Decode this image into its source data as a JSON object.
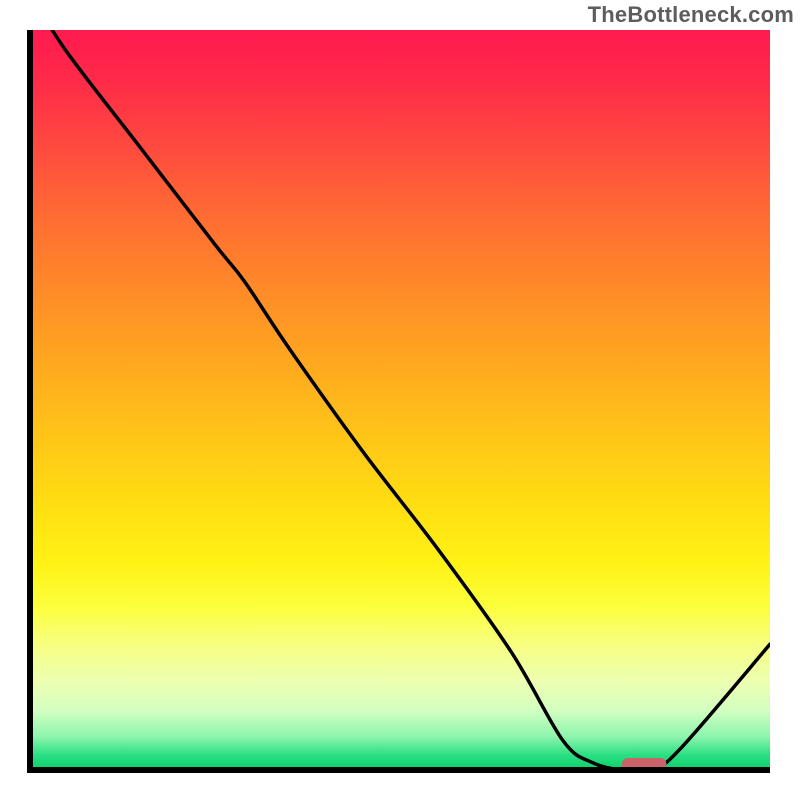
{
  "watermark": "TheBottleneck.com",
  "chart_data": {
    "type": "line",
    "title": "",
    "xlabel": "",
    "ylabel": "",
    "xlim": [
      0,
      100
    ],
    "ylim": [
      0,
      100
    ],
    "grid": false,
    "x": [
      0,
      5,
      15,
      25,
      29,
      35,
      45,
      55,
      65,
      72,
      76,
      80,
      84,
      88,
      100
    ],
    "values": [
      105,
      97,
      84,
      71,
      66,
      57,
      43,
      30,
      16,
      4,
      1,
      0,
      0,
      3,
      17
    ],
    "marker": {
      "x_start": 80,
      "x_end": 86,
      "y": 0,
      "color": "#c96269"
    },
    "gradient_stops": [
      {
        "offset": 0.0,
        "color": "#ff1a4f"
      },
      {
        "offset": 0.07,
        "color": "#ff2b48"
      },
      {
        "offset": 0.15,
        "color": "#ff4740"
      },
      {
        "offset": 0.25,
        "color": "#ff6b33"
      },
      {
        "offset": 0.35,
        "color": "#ff8a28"
      },
      {
        "offset": 0.45,
        "color": "#ffa81f"
      },
      {
        "offset": 0.55,
        "color": "#ffc518"
      },
      {
        "offset": 0.65,
        "color": "#ffe012"
      },
      {
        "offset": 0.72,
        "color": "#fff215"
      },
      {
        "offset": 0.78,
        "color": "#fcff3d"
      },
      {
        "offset": 0.83,
        "color": "#f7ff80"
      },
      {
        "offset": 0.88,
        "color": "#edffb2"
      },
      {
        "offset": 0.92,
        "color": "#d2ffc0"
      },
      {
        "offset": 0.955,
        "color": "#8cf5ad"
      },
      {
        "offset": 0.98,
        "color": "#2adf82"
      },
      {
        "offset": 1.0,
        "color": "#0cce6b"
      }
    ],
    "axis_color": "#000000",
    "line_color": "#000000"
  }
}
